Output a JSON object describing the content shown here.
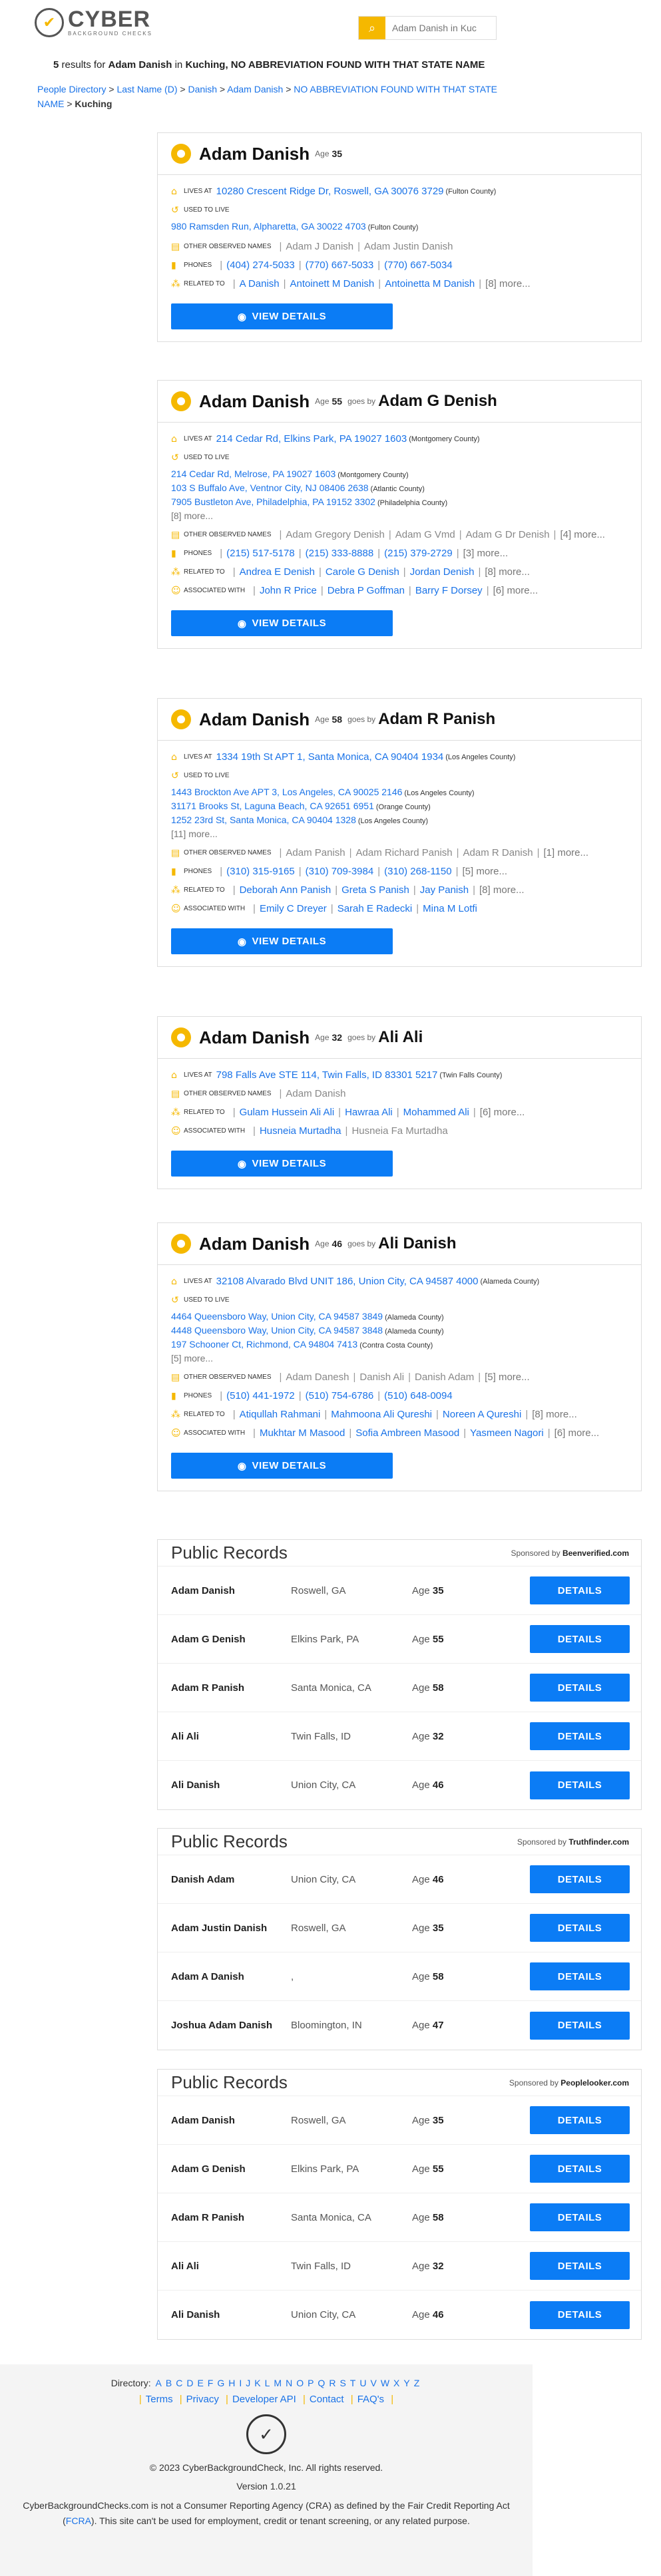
{
  "header": {
    "logo_title": "CYBER",
    "logo_sub": "BACKGROUND CHECKS",
    "search_placeholder": "Adam Danish in Kuc",
    "search_icon": "search-icon"
  },
  "results_count": {
    "num": "5",
    "t1": "results for",
    "name": "Adam Danish",
    "t2": "in",
    "city": "Kuching",
    "t3": ", NO ABBREVIATION FOUND WITH THAT STATE NAME"
  },
  "breadcrumb": {
    "people_directory": "People Directory",
    "sep": ">",
    "last_names": "Last Name (D)",
    "danish": "Danish",
    "adam_danish": "Adam Danish",
    "state": "NO ABBREVIATION FOUND WITH THAT STATE NAME",
    "city": "Kuching"
  },
  "labels": {
    "age": "Age",
    "goes_by": "goes by",
    "lives_at": "LIVES AT",
    "used_to_live": "USED TO LIVE",
    "other_names": "OTHER OBSERVED NAMES",
    "phones": "PHONES",
    "related_to": "RELATED TO",
    "associated_with": "ASSOCIATED WITH",
    "view_details": "VIEW DETAILS",
    "public_records": "Public Records",
    "sponsored_by": "Sponsored by",
    "details": "DETAILS"
  },
  "cards": [
    {
      "name": "Adam Danish",
      "age": "35",
      "alias": "",
      "lives_at": "10280 Crescent Ridge Dr, Roswell, GA 30076 3729",
      "lives_county": "(Fulton County)",
      "used_to_live": [
        {
          "addr": "980 Ramsden Run, Alpharetta, GA 30022 4703",
          "county": "(Fulton County)"
        }
      ],
      "used_more": "",
      "other_names": [
        "Adam J Danish",
        "Adam Justin Danish"
      ],
      "other_more": "",
      "phones": [
        "(404) 274-5033",
        "(770) 667-5033",
        "(770) 667-5034"
      ],
      "phones_more": "",
      "related": [
        "A Danish",
        "Antoinett M Danish",
        "Antoinetta M Danish"
      ],
      "related_more": "[8] more...",
      "associated": [],
      "assoc_gray": "",
      "assoc_more": ""
    },
    {
      "name": "Adam Danish",
      "age": "55",
      "alias": "Adam G Denish",
      "lives_at": "214 Cedar Rd, Elkins Park, PA 19027 1603",
      "lives_county": "(Montgomery County)",
      "used_to_live": [
        {
          "addr": "214 Cedar Rd, Melrose, PA 19027 1603",
          "county": "(Montgomery County)"
        },
        {
          "addr": "103 S Buffalo Ave, Ventnor City, NJ 08406 2638",
          "county": "(Atlantic County)"
        },
        {
          "addr": "7905 Bustleton Ave, Philadelphia, PA 19152 3302",
          "county": "(Philadelphia County)"
        }
      ],
      "used_more": "[8] more...",
      "other_names": [
        "Adam Gregory Denish",
        "Adam G Vmd",
        "Adam G Dr Denish"
      ],
      "other_more": "[4] more...",
      "phones": [
        "(215) 517-5178",
        "(215) 333-8888",
        "(215) 379-2729"
      ],
      "phones_more": "[3] more...",
      "related": [
        "Andrea E Denish",
        "Carole G Denish",
        "Jordan Denish"
      ],
      "related_more": "[8] more...",
      "associated": [
        "John R Price",
        "Debra P Goffman",
        "Barry F Dorsey"
      ],
      "assoc_gray": "",
      "assoc_more": "[6] more..."
    },
    {
      "name": "Adam Danish",
      "age": "58",
      "alias": "Adam R Panish",
      "lives_at": "1334 19th St APT 1, Santa Monica, CA 90404 1934",
      "lives_county": "(Los Angeles County)",
      "used_to_live": [
        {
          "addr": "1443 Brockton Ave APT 3, Los Angeles, CA 90025 2146",
          "county": "(Los Angeles County)"
        },
        {
          "addr": "31171 Brooks St, Laguna Beach, CA 92651 6951",
          "county": "(Orange County)"
        },
        {
          "addr": "1252 23rd St, Santa Monica, CA 90404 1328",
          "county": "(Los Angeles County)"
        }
      ],
      "used_more": "[11] more...",
      "other_names": [
        "Adam Panish",
        "Adam Richard Panish",
        "Adam R Danish"
      ],
      "other_more": "[1] more...",
      "phones": [
        "(310) 315-9165",
        "(310) 709-3984",
        "(310) 268-1150"
      ],
      "phones_more": "[5] more...",
      "related": [
        "Deborah Ann Panish",
        "Greta S Panish",
        "Jay Panish"
      ],
      "related_more": "[8] more...",
      "associated": [
        "Emily C Dreyer",
        "Sarah E Radecki",
        "Mina M Lotfi"
      ],
      "assoc_gray": "",
      "assoc_more": ""
    },
    {
      "name": "Adam Danish",
      "age": "32",
      "alias": "Ali Ali",
      "lives_at": "798 Falls Ave STE 114, Twin Falls, ID 83301 5217",
      "lives_county": "(Twin Falls County)",
      "used_to_live": [],
      "used_more": "",
      "other_names": [
        "Adam Danish"
      ],
      "other_more": "",
      "phones": [],
      "phones_more": "",
      "related": [
        "Gulam Hussein Ali Ali",
        "Hawraa Ali",
        "Mohammed Ali"
      ],
      "related_more": "[6] more...",
      "associated": [
        "Husneia Murtadha"
      ],
      "assoc_gray": "Husneia Fa Murtadha",
      "assoc_more": ""
    },
    {
      "name": "Adam Danish",
      "age": "46",
      "alias": "Ali Danish",
      "lives_at": "32108 Alvarado Blvd UNIT 186, Union City, CA 94587 4000",
      "lives_county": "(Alameda County)",
      "used_to_live": [
        {
          "addr": "4464 Queensboro Way, Union City, CA 94587 3849",
          "county": "(Alameda County)"
        },
        {
          "addr": "4448 Queensboro Way, Union City, CA 94587 3848",
          "county": "(Alameda County)"
        },
        {
          "addr": "197 Schooner Ct, Richmond, CA 94804 7413",
          "county": "(Contra Costa County)"
        }
      ],
      "used_more": "[5] more...",
      "other_names": [
        "Adam Danesh",
        "Danish Ali",
        "Danish Adam"
      ],
      "other_more": "[5] more...",
      "phones": [
        "(510) 441-1972",
        "(510) 754-6786",
        "(510) 648-0094"
      ],
      "phones_more": "",
      "related": [
        "Atiqullah Rahmani",
        "Mahmoona Ali Qureshi",
        "Noreen A Qureshi"
      ],
      "related_more": "[8] more...",
      "associated": [
        "Mukhtar M Masood",
        "Sofia Ambreen Masood",
        "Yasmeen Nagori"
      ],
      "assoc_gray": "",
      "assoc_more": "[6] more..."
    }
  ],
  "public_records": [
    {
      "sponsor": "Beenverified.com",
      "rows": [
        {
          "name": "Adam Danish",
          "city": "Roswell, GA",
          "age": "35"
        },
        {
          "name": "Adam G Denish",
          "city": "Elkins Park, PA",
          "age": "55"
        },
        {
          "name": "Adam R Panish",
          "city": "Santa Monica, CA",
          "age": "58"
        },
        {
          "name": "Ali Ali",
          "city": "Twin Falls, ID",
          "age": "32"
        },
        {
          "name": "Ali Danish",
          "city": "Union City, CA",
          "age": "46"
        }
      ]
    },
    {
      "sponsor": "Truthfinder.com",
      "rows": [
        {
          "name": "Danish Adam",
          "city": "Union City, CA",
          "age": "46"
        },
        {
          "name": "Adam Justin Danish",
          "city": "Roswell, GA",
          "age": "35"
        },
        {
          "name": "Adam A Danish",
          "city": ",",
          "age": "58"
        },
        {
          "name": "Joshua Adam Danish",
          "city": "Bloomington, IN",
          "age": "47"
        }
      ]
    },
    {
      "sponsor": "Peoplelooker.com",
      "rows": [
        {
          "name": "Adam Danish",
          "city": "Roswell, GA",
          "age": "35"
        },
        {
          "name": "Adam G Denish",
          "city": "Elkins Park, PA",
          "age": "55"
        },
        {
          "name": "Adam R Panish",
          "city": "Santa Monica, CA",
          "age": "58"
        },
        {
          "name": "Ali Ali",
          "city": "Twin Falls, ID",
          "age": "32"
        },
        {
          "name": "Ali Danish",
          "city": "Union City, CA",
          "age": "46"
        }
      ]
    }
  ],
  "footer": {
    "directory_label": "Directory:",
    "letters": [
      "A",
      "B",
      "C",
      "D",
      "E",
      "F",
      "G",
      "H",
      "I",
      "J",
      "K",
      "L",
      "M",
      "N",
      "O",
      "P",
      "Q",
      "R",
      "S",
      "T",
      "U",
      "V",
      "W",
      "X",
      "Y",
      "Z"
    ],
    "links": [
      "Terms",
      "Privacy",
      "Developer API",
      "Contact",
      "FAQ's"
    ],
    "pipe": "|",
    "copyright": "© 2023 CyberBackgroundCheck, Inc. All rights reserved.",
    "version": "Version 1.0.21",
    "disclaimer_1": "CyberBackgroundChecks.com is not a Consumer Reporting Agency (CRA) as defined by the Fair Credit Reporting Act (",
    "fcra": "FCRA",
    "disclaimer_2": "). This site can't be used for employment, credit or tenant screening, or any related purpose."
  },
  "colors": {
    "accent": "#f5b800",
    "link": "#1a73e8",
    "button": "#0b7cf5"
  }
}
